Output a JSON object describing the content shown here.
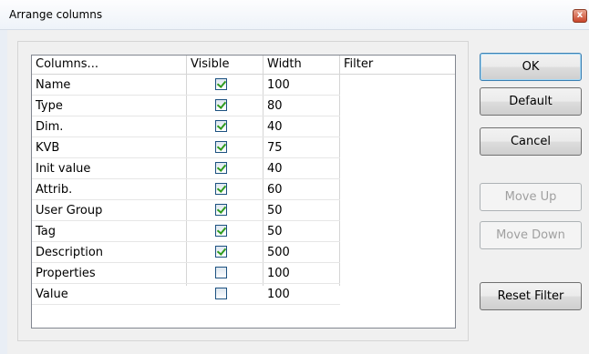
{
  "window": {
    "title": "Arrange columns",
    "close_glyph": "x"
  },
  "table": {
    "headers": [
      "Columns...",
      "Visible",
      "Width",
      "Filter"
    ],
    "rows": [
      {
        "name": "Name",
        "visible": true,
        "width": "100",
        "filter": ""
      },
      {
        "name": "Type",
        "visible": true,
        "width": "80",
        "filter": ""
      },
      {
        "name": "Dim.",
        "visible": true,
        "width": "40",
        "filter": ""
      },
      {
        "name": "KVB",
        "visible": true,
        "width": "75",
        "filter": ""
      },
      {
        "name": "Init value",
        "visible": true,
        "width": "40",
        "filter": ""
      },
      {
        "name": "Attrib.",
        "visible": true,
        "width": "60",
        "filter": ""
      },
      {
        "name": "User Group",
        "visible": true,
        "width": "50",
        "filter": ""
      },
      {
        "name": "Tag",
        "visible": true,
        "width": "50",
        "filter": ""
      },
      {
        "name": "Description",
        "visible": true,
        "width": "500",
        "filter": ""
      },
      {
        "name": "Properties",
        "visible": false,
        "width": "100",
        "filter": ""
      },
      {
        "name": "Value",
        "visible": false,
        "width": "100",
        "filter": ""
      }
    ]
  },
  "buttons": {
    "ok": "OK",
    "default": "Default",
    "cancel": "Cancel",
    "move_up": "Move Up",
    "move_down": "Move Down",
    "reset_filter": "Reset Filter"
  }
}
